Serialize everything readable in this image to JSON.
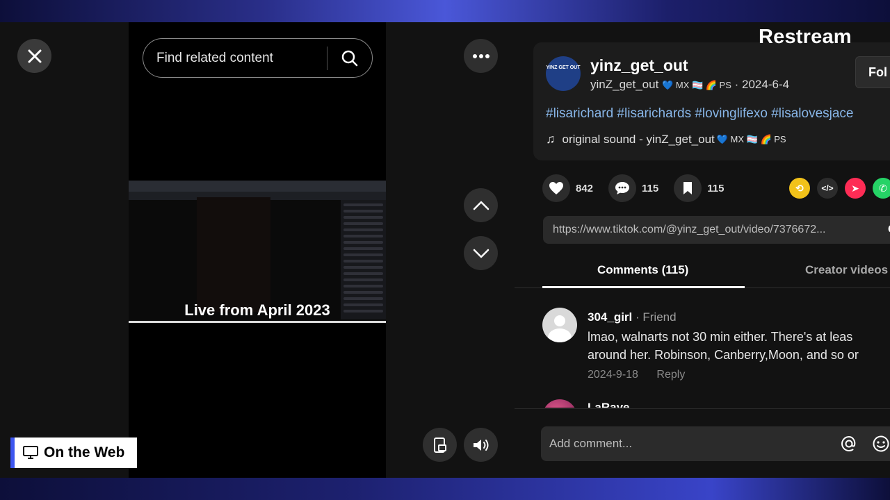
{
  "overlay": {
    "brand": "Restream",
    "badge_label": "On the Web"
  },
  "search": {
    "placeholder": "Find related content"
  },
  "video": {
    "caption": "Live from April 2023"
  },
  "post": {
    "avatar_text": "YINZ GET OUT",
    "username": "yinz_get_out",
    "display_name": "yinZ_get_out",
    "date": "2024-6-4",
    "follow_label": "Fol",
    "hashtags": "#lisarichard #lisarichards #lovinglifexo #lisalovesjace",
    "sound": "original sound - yinZ_get_out"
  },
  "stats": {
    "likes": "842",
    "comments": "115",
    "saves": "115"
  },
  "link": {
    "url": "https://www.tiktok.com/@yinz_get_out/video/7376672...",
    "copy_label": "Co"
  },
  "tabs": {
    "comments": "Comments (115)",
    "creator": "Creator videos"
  },
  "comments": [
    {
      "user": "304_girl",
      "relation": "· Friend",
      "line1": "lmao, walnarts not 30 min either. There's at leas",
      "line2": "around her. Robinson, Canberry,Moon, and so or",
      "date": "2024-9-18",
      "reply": "Reply"
    },
    {
      "user": "LaRaye"
    }
  ],
  "compose": {
    "placeholder": "Add comment..."
  },
  "colors": {
    "accent_blue": "#3d56f0",
    "hashtag": "#88b6e8"
  }
}
